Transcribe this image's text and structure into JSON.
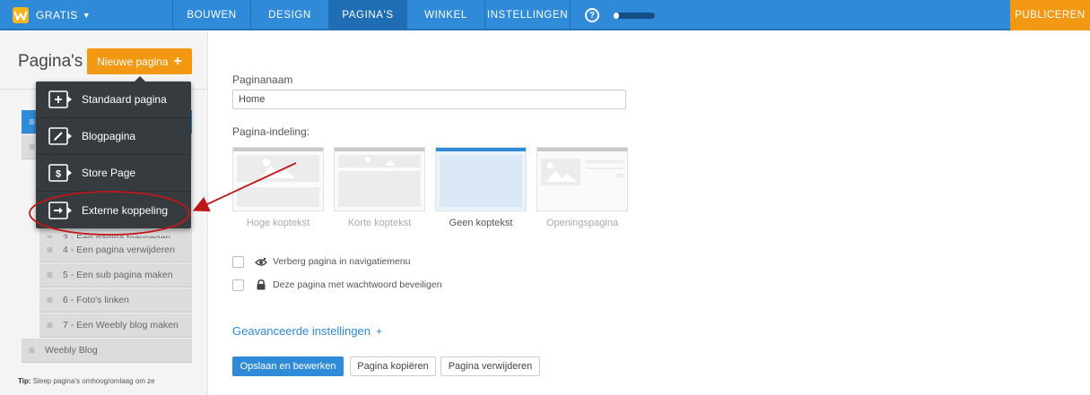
{
  "topbar": {
    "brand_label": "GRATIS",
    "tabs": [
      {
        "label": "BOUWEN"
      },
      {
        "label": "DESIGN"
      },
      {
        "label": "PAGINA'S"
      },
      {
        "label": "WINKEL"
      },
      {
        "label": "INSTELLINGEN"
      }
    ],
    "active_tab": "PAGINA'S",
    "help_label": "?",
    "progress_fraction": 0.12,
    "publish_label": "PUBLICEREN",
    "colors": {
      "bar": "#2f8ad8",
      "publish": "#f39812"
    }
  },
  "sidebar": {
    "title": "Pagina's",
    "new_page_label": "Nieuwe pagina",
    "new_page_plus": "+",
    "pages": [
      {
        "label": "",
        "selected": true
      },
      {
        "label": "",
        "selected": false
      },
      {
        "label": "3 - Een pagina toevoegen",
        "selected": false
      },
      {
        "label": "4 - Een pagina verwijderen",
        "selected": false
      },
      {
        "label": "5 - Een sub pagina maken",
        "selected": false
      },
      {
        "label": "6 - Foto's linken",
        "selected": false
      },
      {
        "label": "7 - Een Weebly blog maken",
        "selected": false
      },
      {
        "label": "Weebly Blog",
        "selected": false
      }
    ],
    "tip_label": "Tip:",
    "tip_text": "Sleep pagina's omhoog/omlaag om ze"
  },
  "dropdown": {
    "items": [
      {
        "label": "Standaard pagina",
        "icon": "plus-page-icon"
      },
      {
        "label": "Blogpagina",
        "icon": "pen-page-icon"
      },
      {
        "label": "Store Page",
        "icon": "dollar-page-icon"
      },
      {
        "label": "Externe koppeling",
        "icon": "arrow-page-icon"
      }
    ],
    "highlighted": "Externe koppeling",
    "annotation_color": "#c0171b"
  },
  "main": {
    "page_name_label": "Paginanaam",
    "page_name_value": "Home",
    "layout_label": "Pagina-indeling:",
    "layouts": [
      {
        "label": "Hoge koptekst",
        "active": false
      },
      {
        "label": "Korte koptekst",
        "active": false
      },
      {
        "label": "Geen koptekst",
        "active": true
      },
      {
        "label": "Openingspagina",
        "active": false
      }
    ],
    "options": [
      {
        "label": "Verberg pagina in navigatiemenu",
        "icon": "eye-slash-icon",
        "checked": false
      },
      {
        "label": "Deze pagina met wachtwoord beveiligen",
        "icon": "lock-icon",
        "checked": false
      }
    ],
    "advanced_label": "Geavanceerde instellingen",
    "advanced_plus": "+",
    "buttons": {
      "save": "Opslaan en bewerken",
      "copy": "Pagina kopiëren",
      "delete": "Pagina verwijderen"
    }
  }
}
